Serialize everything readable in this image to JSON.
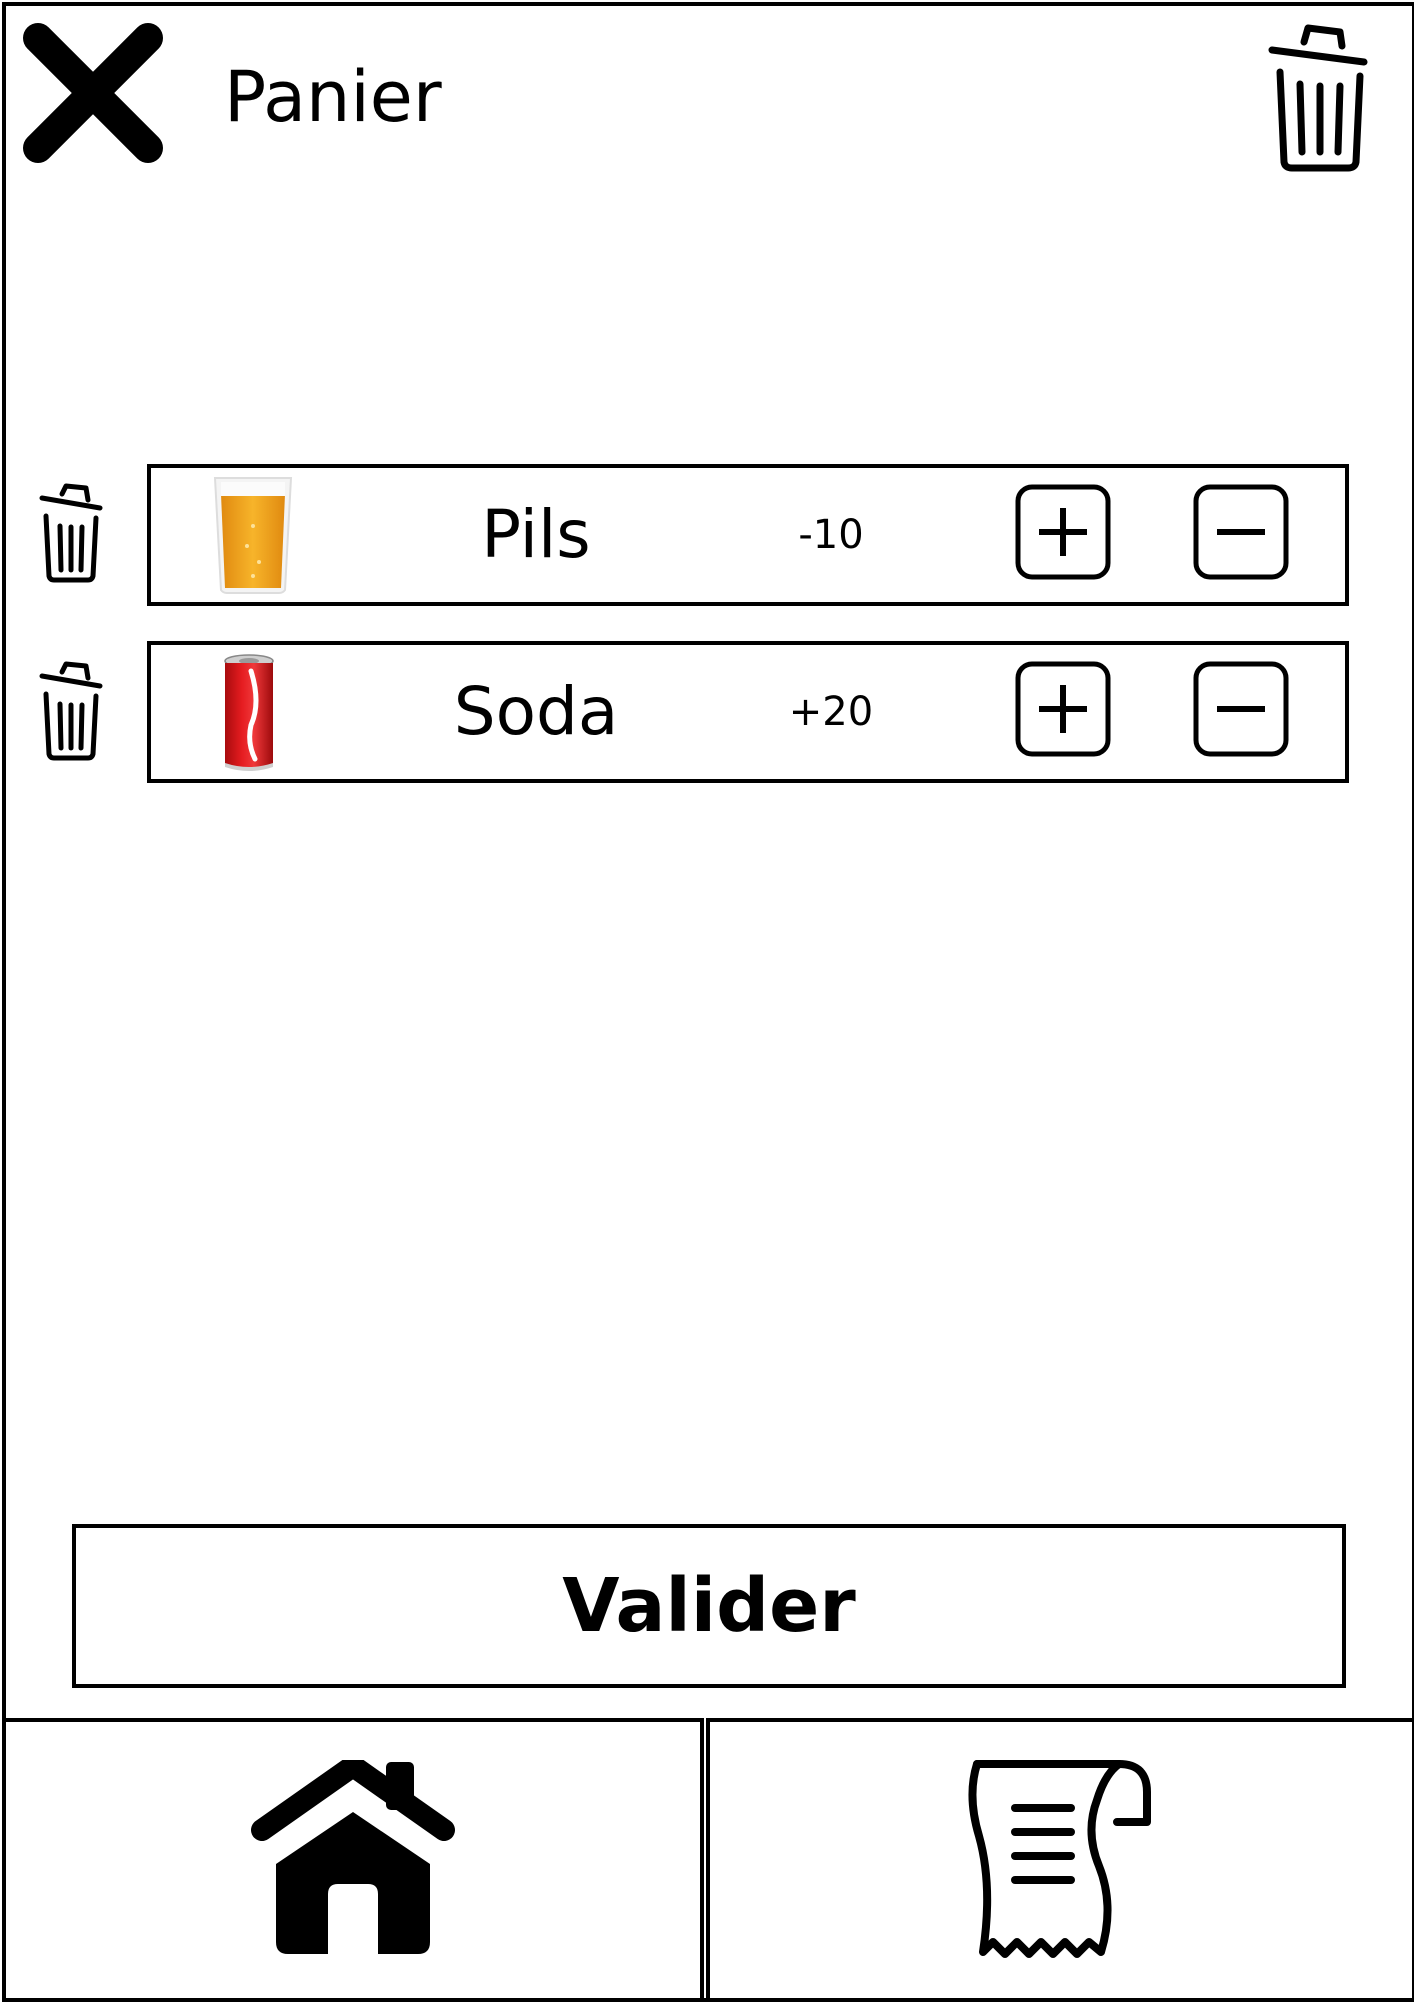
{
  "header": {
    "title": "Panier",
    "close_icon": "close-icon",
    "clear_icon": "trash-icon"
  },
  "cart": {
    "items": [
      {
        "name": "Pils",
        "quantity": "-10",
        "image": "beer-glass-icon",
        "delete_icon": "trash-icon",
        "plus_icon": "plus-icon",
        "minus_icon": "minus-icon"
      },
      {
        "name": "Soda",
        "quantity": "+20",
        "image": "soda-can-icon",
        "delete_icon": "trash-icon",
        "plus_icon": "plus-icon",
        "minus_icon": "minus-icon"
      }
    ]
  },
  "actions": {
    "validate_label": "Valider"
  },
  "bottom_nav": {
    "items": [
      {
        "icon": "home-icon"
      },
      {
        "icon": "receipt-icon"
      }
    ]
  },
  "colors": {
    "foreground": "#000000",
    "background": "#ffffff",
    "beer": "#f2a81d",
    "soda": "#d9161a"
  }
}
